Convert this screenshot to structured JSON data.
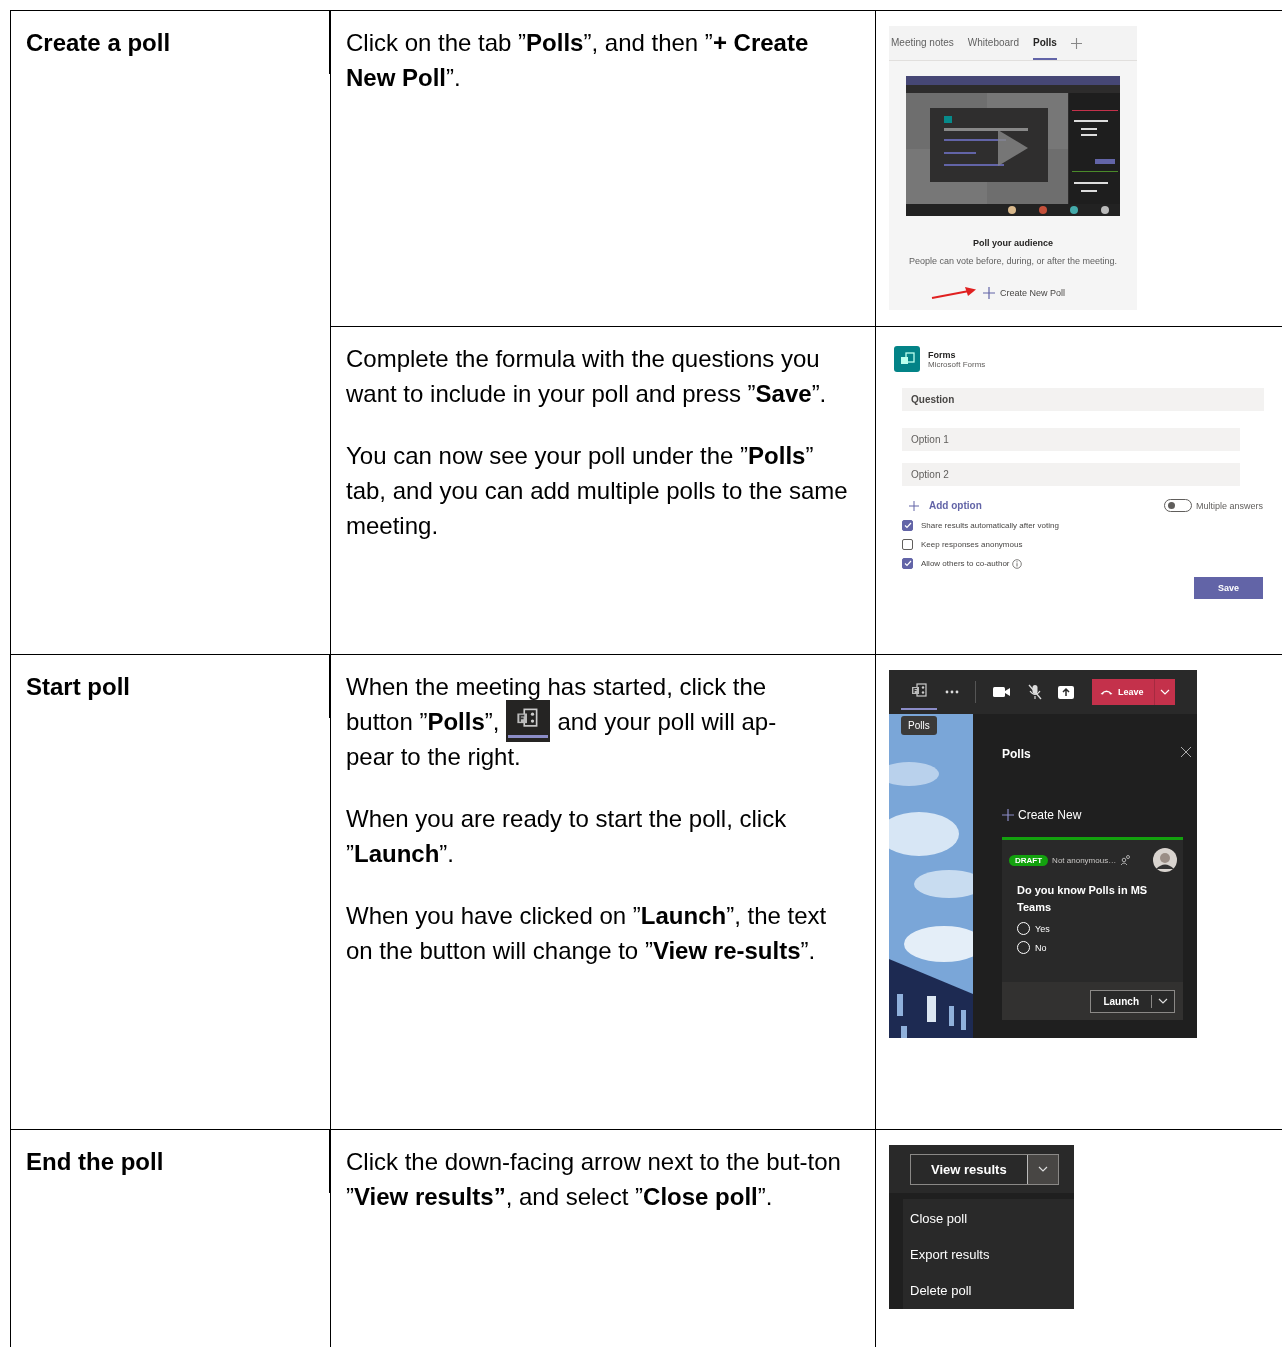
{
  "table": {
    "rows": [
      {
        "title": "Create a poll",
        "steps": [
          {
            "paragraphs": [
              {
                "text": "Click on the tab ”**Polls**”, and then ”**+ Create New Poll**”."
              }
            ],
            "screenshot": {
              "kind": "polls_tab",
              "tabs": [
                {
                  "label": "Meeting notes",
                  "selected": false
                },
                {
                  "label": "Whiteboard",
                  "selected": false
                },
                {
                  "label": "Polls",
                  "selected": true
                }
              ],
              "heading": "Poll your audience",
              "description": "People can vote before, during, or after the meeting.",
              "create_button": "Create New Poll"
            }
          },
          {
            "paragraphs": [
              {
                "text": "Complete the formula with the questions you want to include in your poll and press ”**Save**”."
              },
              {
                "text": "You can now see your poll under the ”**Polls**” tab, and you can add multiple polls to the same meeting."
              }
            ],
            "screenshot": {
              "kind": "forms",
              "app_name": "Forms",
              "app_subtitle": "Microsoft Forms",
              "question_placeholder": "Question",
              "options": [
                {
                  "placeholder": "Option 1"
                },
                {
                  "placeholder": "Option 2"
                }
              ],
              "add_option": "Add option",
              "multiple_answers": {
                "label": "Multiple answers",
                "on": false
              },
              "settings": [
                {
                  "label": "Share results automatically after voting",
                  "checked": true,
                  "has_info": false
                },
                {
                  "label": "Keep responses anonymous",
                  "checked": false,
                  "has_info": false
                },
                {
                  "label": "Allow others to co-author",
                  "checked": true,
                  "has_info": true
                }
              ],
              "save_button": "Save"
            }
          }
        ]
      },
      {
        "title": "Start poll",
        "steps": [
          {
            "paragraphs": [
              {
                "lines": [
                  [
                    {
                      "kind": "text",
                      "text": "When the meeting has started, click the"
                    }
                  ],
                  [
                    {
                      "kind": "text",
                      "text": "button ”**Polls**”,"
                    },
                    {
                      "kind": "polls_icon"
                    },
                    {
                      "kind": "text",
                      "text": "and your poll will ap-"
                    }
                  ],
                  [
                    {
                      "kind": "text",
                      "text": "pear to the right."
                    }
                  ]
                ]
              },
              {
                "text": "When you are ready to start the poll, click ”**Launch**”."
              },
              {
                "text": "When you have clicked on ”**Launch**”, the text on the button will change to ”**View re-sults**”."
              }
            ],
            "screenshot": {
              "kind": "meeting",
              "tooltip": "Polls",
              "leave_button": "Leave",
              "panel_title": "Polls",
              "create_button": "Create New",
              "poll": {
                "status": "DRAFT",
                "anonymity": "Not anonymous…",
                "question": "Do you know Polls in MS Teams",
                "options": [
                  {
                    "label": "Yes",
                    "selected": false
                  },
                  {
                    "label": "No",
                    "selected": false
                  }
                ],
                "launch_button": "Launch"
              }
            }
          }
        ]
      },
      {
        "title": "End the poll",
        "steps": [
          {
            "paragraphs": [
              {
                "text": "Click the down-facing arrow next to the but-ton ”**View results”**, and select ”**Close poll**”."
              }
            ],
            "screenshot": {
              "kind": "poll_menu",
              "button": "View results",
              "menu": [
                "Close poll",
                "Export results",
                "Delete poll"
              ]
            }
          }
        ]
      }
    ]
  }
}
